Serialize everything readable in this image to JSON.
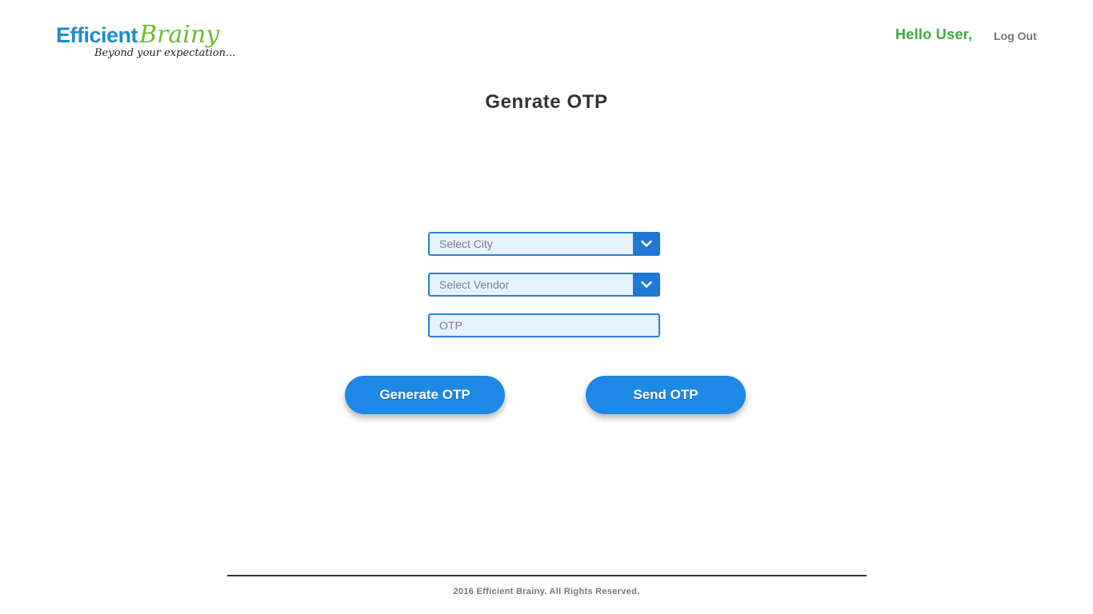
{
  "header": {
    "logo": {
      "word1": "Efficient",
      "word2": "Brainy",
      "tagline": "Beyond your expectation...",
      "colors": {
        "word1": "#1b8ccd",
        "word2": "#6dbb2f"
      }
    },
    "greeting": "Hello User,",
    "logout_label": "Log Out"
  },
  "main": {
    "title": "Genrate OTP",
    "city_select": {
      "placeholder": "Select City",
      "icon": "chevron-down-icon"
    },
    "vendor_select": {
      "placeholder": "Select Vendor",
      "icon": "chevron-down-icon"
    },
    "otp_input": {
      "placeholder": "OTP",
      "value": ""
    },
    "generate_button_label": "Generate OTP",
    "send_button_label": "Send OTP"
  },
  "footer": {
    "copyright": "2016 Efficient Brainy. All Rights Reserved."
  },
  "colors": {
    "accent": "#1e88e5",
    "field_border": "#2780d8",
    "field_bg": "#e6f2fd",
    "greeting": "#3daa3f"
  }
}
